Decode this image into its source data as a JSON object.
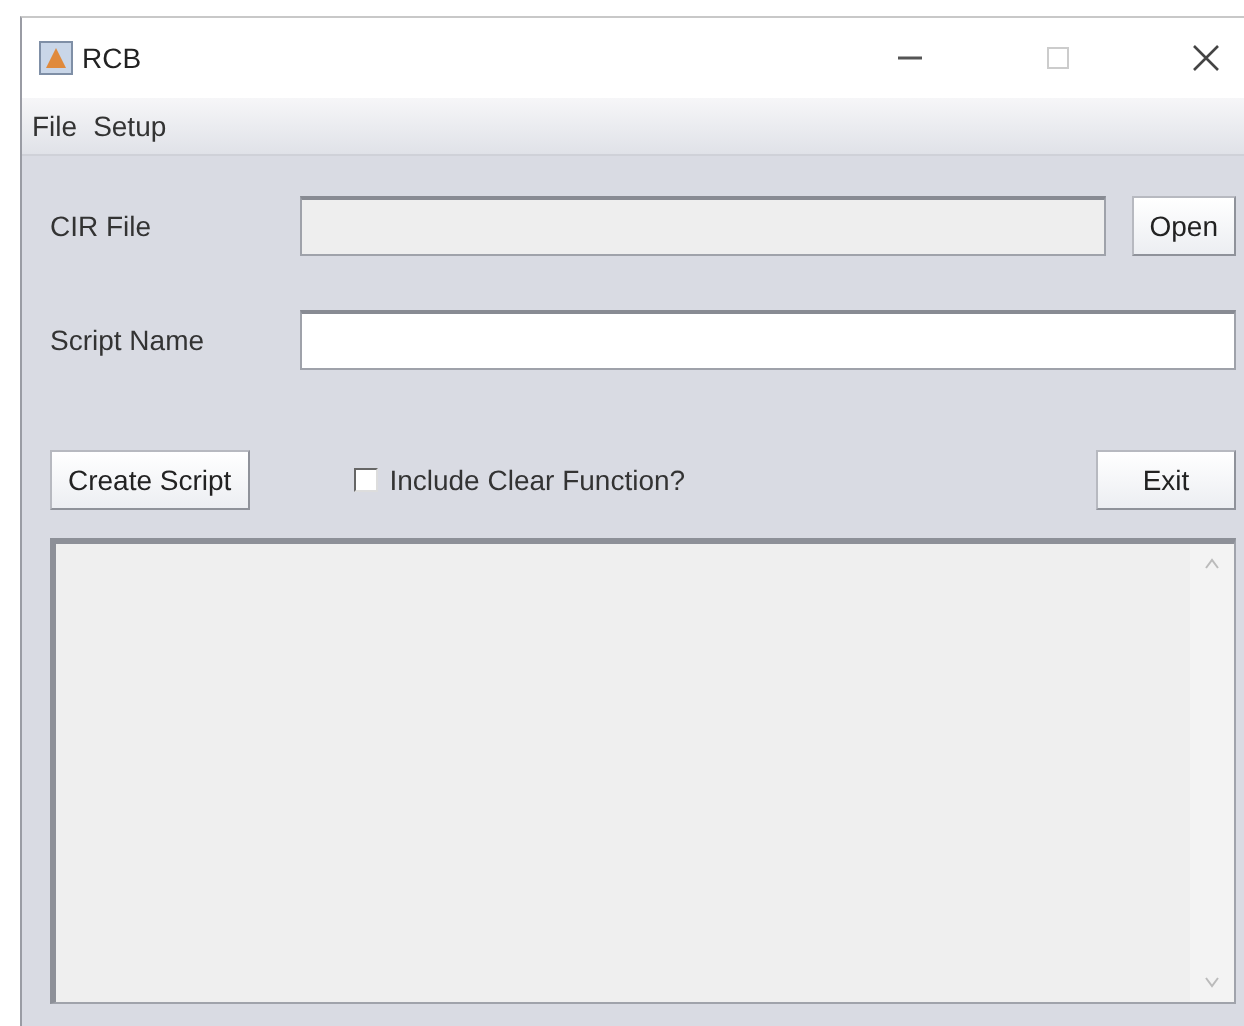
{
  "window": {
    "title": "RCB"
  },
  "menu": [
    "File",
    "Setup"
  ],
  "cir_file": {
    "label": "CIR File",
    "disabled": true,
    "button": "Open"
  },
  "script_name": {
    "label": "Script Name"
  },
  "actions": {
    "create_button": "Create Script",
    "checkbox": {
      "label": "Include Clear Function?",
      "checked": false
    },
    "exit_button": "Exit"
  },
  "output": {
    "disabled": true
  }
}
